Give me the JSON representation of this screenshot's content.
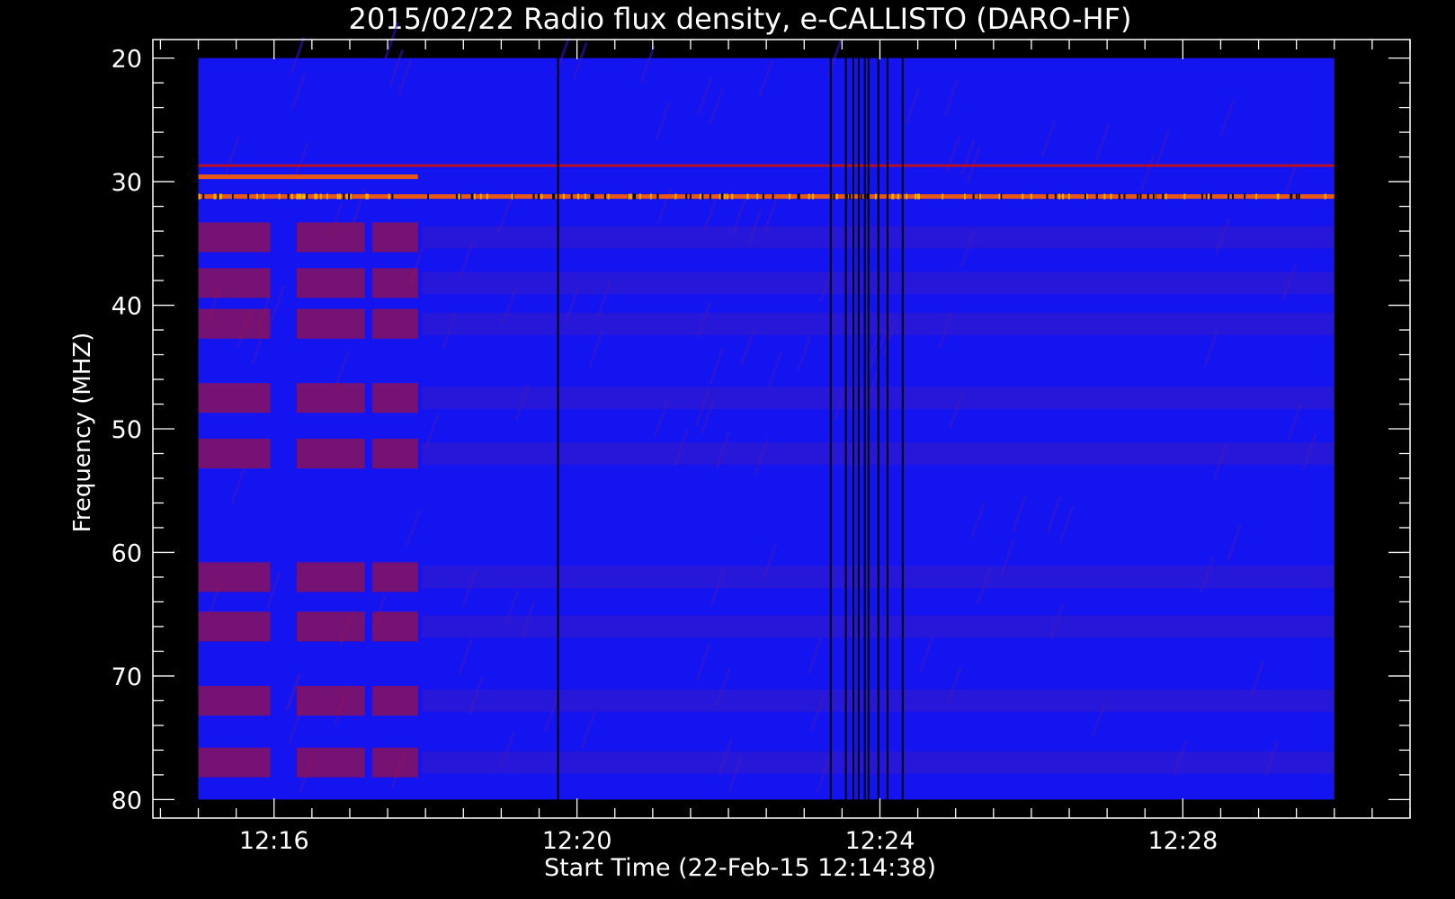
{
  "chart_data": {
    "type": "heatmap",
    "title": "2015/02/22  Radio flux density, e-CALLISTO (DARO-HF)",
    "xlabel": "Start Time (22-Feb-15 12:14:38)",
    "ylabel": "Frequency (MHZ)",
    "x_ticks": [
      "12:16",
      "12:20",
      "12:24",
      "12:28"
    ],
    "x_tick_minutes": [
      16,
      20,
      24,
      28
    ],
    "xlim_minutes": [
      14.4,
      31.0
    ],
    "data_time_range_minutes": [
      15.0,
      30.0
    ],
    "y_ticks": [
      20,
      30,
      40,
      50,
      60,
      70,
      80
    ],
    "ylim": [
      18.5,
      81.5
    ],
    "y_inverted": true,
    "frequency_range": [
      20,
      80
    ],
    "colors": {
      "background": "#1414f0",
      "emission_strong": "#ff6000",
      "emission_medium": "#c81010",
      "dark_band": "#000000",
      "axes": "#ffffff",
      "page": "#000000"
    },
    "emission_lanes": [
      {
        "freq": 29.6,
        "intensity": "strong",
        "t_start": 15.0,
        "t_end": 17.9
      },
      {
        "freq": 31.2,
        "intensity": "strong",
        "t_start": 15.0,
        "t_end": 30.0
      },
      {
        "freq": 28.7,
        "intensity": "medium",
        "t_start": 15.0,
        "t_end": 30.0
      }
    ],
    "interference_blocks_freqs": [
      34.5,
      38.2,
      41.5,
      47.5,
      52.0,
      62.0,
      66.0,
      72.0,
      77.0
    ],
    "interference_block_segments": [
      [
        15.0,
        15.95
      ],
      [
        16.3,
        17.2
      ],
      [
        17.3,
        17.9
      ]
    ],
    "vertical_dark_lines_minutes": [
      23.35,
      23.55,
      23.65,
      23.72,
      23.8,
      23.85,
      23.98,
      24.1,
      24.3,
      19.75
    ]
  }
}
